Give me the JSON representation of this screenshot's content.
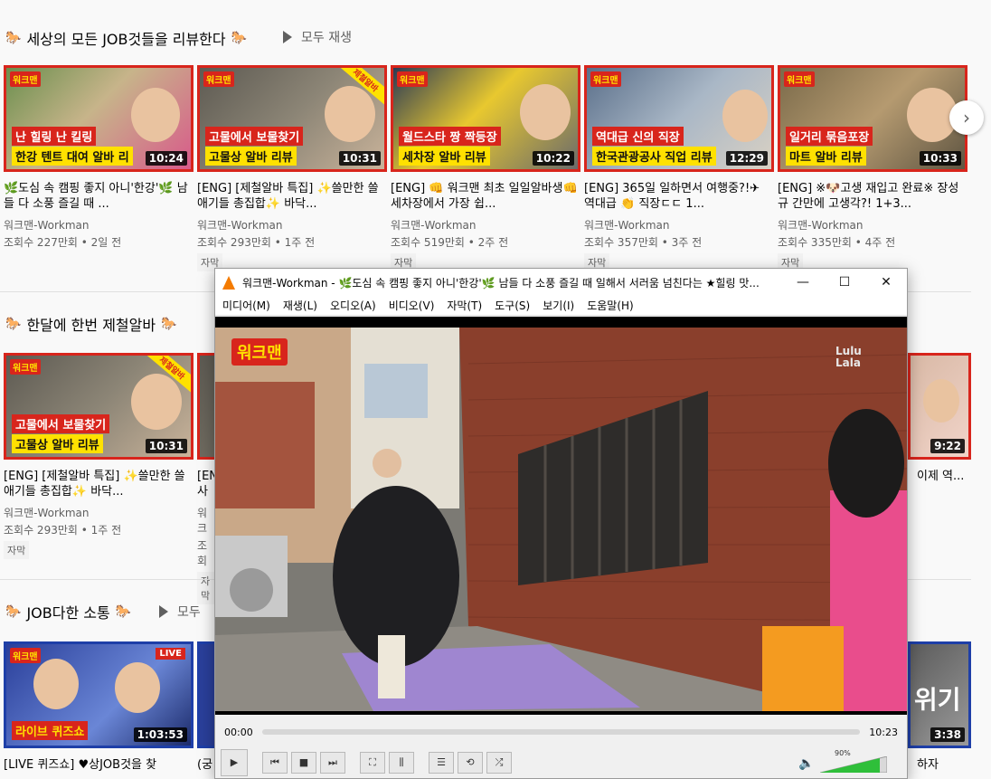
{
  "shelves": [
    {
      "title": "세상의 모든 JOB것들을 리뷰한다",
      "play_all": "모두 재생"
    },
    {
      "title": "한달에 한번 제철알바",
      "play_all": ""
    },
    {
      "title": "JOB다한 소통",
      "play_all": "모두"
    }
  ],
  "row1": [
    {
      "title": "🌿도심 속 캠핑 좋지 아니'한강'🌿 남들 다 소풍 즐길 때 ...",
      "channel": "워크맨-Workman",
      "meta": "조회수 227만회 • 2일 전",
      "badge": "",
      "cap1": "난 힐링 난 킬링",
      "cap2": "한강 텐트 대여 알바 리",
      "duration": "10:24",
      "corner": ""
    },
    {
      "title": "[ENG] [제철알바 특집] ✨쓸만한 쓸애기들 총집합✨ 바닥...",
      "channel": "워크맨-Workman",
      "meta": "조회수 293만회 • 1주 전",
      "badge": "자막",
      "cap1": "고물에서 보물찾기",
      "cap2": "고물상 알바 리뷰",
      "duration": "10:31",
      "corner": "제철알바"
    },
    {
      "title": "[ENG] 👊 워크맨 최초 일일알바생👊 세차장에서 가장 쉽...",
      "channel": "워크맨-Workman",
      "meta": "조회수 519만회 • 2주 전",
      "badge": "자막",
      "cap1": "월드스타 짱 짝등장",
      "cap2": "세차장 알바 리뷰",
      "duration": "10:22",
      "corner": ""
    },
    {
      "title": "[ENG] 365일 일하면서 여행중?!✈ 역대급 👏 직장ㄷㄷ 1...",
      "channel": "워크맨-Workman",
      "meta": "조회수 357만회 • 3주 전",
      "badge": "자막",
      "cap1": "역대급 신의 직장",
      "cap2": "한국관광공사 직업 리뷰",
      "duration": "12:29",
      "corner": ""
    },
    {
      "title": "[ENG] ※🐶고생 재입고 완료※ 장성규 간만에 고생각?! 1+3...",
      "channel": "워크맨-Workman",
      "meta": "조회수 335만회 • 4주 전",
      "badge": "자막",
      "cap1": "일거리 묶음포장",
      "cap2": "마트 알바 리뷰",
      "duration": "10:33",
      "corner": ""
    }
  ],
  "row2": [
    {
      "title": "[ENG] [제철알바 특집] ✨쓸만한 쓸애기들 총집합✨ 바닥...",
      "channel": "워크맨-Workman",
      "meta": "조회수 293만회 • 1주 전",
      "badge": "자막",
      "cap1": "고물에서 보물찾기",
      "cap2": "고물상 알바 리뷰",
      "duration": "10:31",
      "corner": "제철알바"
    },
    {
      "title": "[EN 사우",
      "channel": "워크",
      "meta": "조회",
      "badge": "자막",
      "duration": ""
    },
    {
      "title": "이제 역...",
      "channel": "",
      "meta": "",
      "badge": "",
      "duration": "9:22",
      "corner": "제철알바"
    }
  ],
  "row3": [
    {
      "title": "[LIVE 퀴즈쇼] ♥상JOB것을 찾",
      "cap1": "라이브 퀴즈쇼",
      "duration": "1:03:53",
      "live": "LIVE"
    },
    {
      "title": "(궁"
    },
    {
      "title": "하자",
      "cap2": "위기",
      "duration": "3:38"
    }
  ],
  "thumb_logo": "워크맨",
  "vlc": {
    "title": "워크맨-Workman - 🌿도심 속 캠핑 좋지 아니'한강'🌿 남들 다 소풍 즐길 때 일해서 서러움 넘친다는 ★힐링 맛...",
    "menu": [
      "미디어(M)",
      "재생(L)",
      "오디오(A)",
      "비디오(V)",
      "자막(T)",
      "도구(S)",
      "보기(I)",
      "도움말(H)"
    ],
    "time_current": "00:00",
    "time_total": "10:23",
    "volume": "90%",
    "video_logo": "워크맨",
    "video_watermark": "Lulu Lala",
    "minimize": "—",
    "maximize": "☐",
    "close": "✕"
  },
  "colors": {
    "accent": "#d8251c",
    "yellow": "#ffe100",
    "vlc_orange": "#f47b00"
  }
}
